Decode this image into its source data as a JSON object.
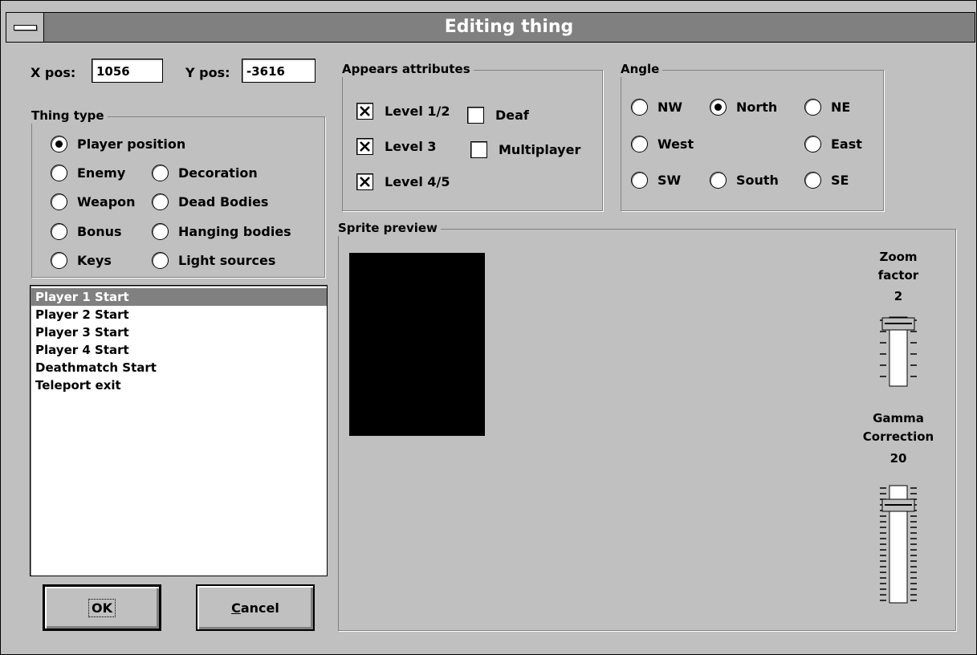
{
  "window": {
    "title": "Editing thing"
  },
  "position": {
    "x_label": "X pos:",
    "x_value": "1056",
    "y_label": "Y pos:",
    "y_value": "-3616"
  },
  "thing_type": {
    "caption": "Thing type",
    "selected": "Player position",
    "options": [
      "Player position",
      "Enemy",
      "Decoration",
      "Weapon",
      "Dead Bodies",
      "Bonus",
      "Hanging bodies",
      "Keys",
      "Light sources"
    ]
  },
  "thing_list": {
    "selected_index": 0,
    "items": [
      "Player 1 Start",
      "Player 2 Start",
      "Player 3 Start",
      "Player 4 Start",
      "Deathmatch Start",
      "Teleport exit"
    ]
  },
  "appears": {
    "caption": "Appears attributes",
    "level12": {
      "label": "Level 1/2",
      "checked": true
    },
    "deaf": {
      "label": "Deaf",
      "checked": false
    },
    "level3": {
      "label": "Level 3",
      "checked": true
    },
    "multiplayer": {
      "label": "Multiplayer",
      "checked": false
    },
    "level45": {
      "label": "Level 4/5",
      "checked": true
    }
  },
  "angle": {
    "caption": "Angle",
    "selected": "North",
    "options": [
      "NW",
      "North",
      "NE",
      "West",
      "East",
      "SW",
      "South",
      "SE"
    ]
  },
  "sprite": {
    "caption": "Sprite preview",
    "zoom_label_1": "Zoom",
    "zoom_label_2": "factor",
    "zoom_value": "2",
    "gamma_label_1": "Gamma",
    "gamma_label_2": "Correction",
    "gamma_value": "20",
    "preview_color": "#000000"
  },
  "buttons": {
    "ok": "OK",
    "cancel_rest": "ancel",
    "cancel_mnemonic": "C"
  },
  "colors": {
    "face": "#c0c0c0",
    "title_bar": "#808080",
    "selection": "#808080"
  }
}
